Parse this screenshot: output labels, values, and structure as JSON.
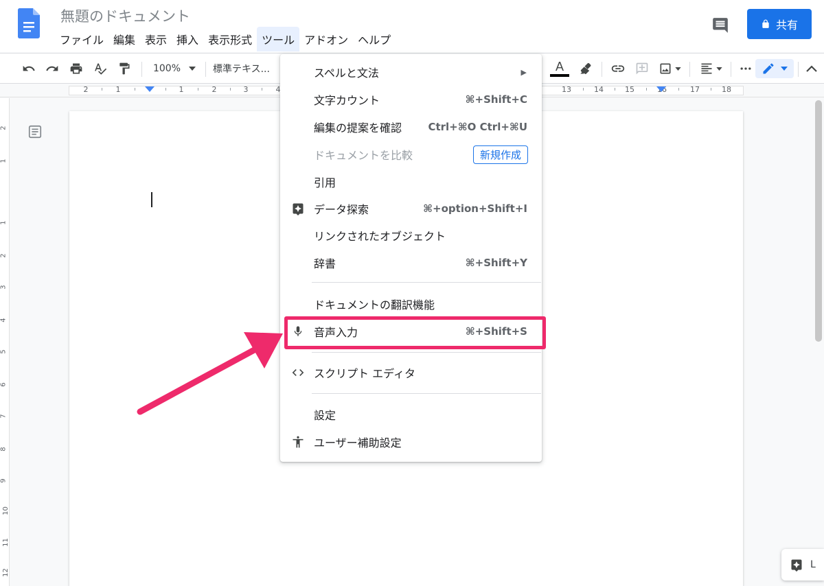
{
  "app": {
    "doc_title": "無題のドキュメント",
    "share_label": "共有",
    "menus": [
      {
        "label": "ファイル",
        "active": false
      },
      {
        "label": "編集",
        "active": false
      },
      {
        "label": "表示",
        "active": false
      },
      {
        "label": "挿入",
        "active": false
      },
      {
        "label": "表示形式",
        "active": false
      },
      {
        "label": "ツール",
        "active": true
      },
      {
        "label": "アドオン",
        "active": false
      },
      {
        "label": "ヘルプ",
        "active": false
      }
    ]
  },
  "toolbar": {
    "zoom": "100%",
    "style": "標準テキス..."
  },
  "ruler": {
    "labels": [
      "2",
      "1",
      "1",
      "2",
      "3",
      "4",
      "13",
      "14",
      "15",
      "16",
      "17",
      "18"
    ],
    "vlabels": [
      "2",
      "1",
      "1",
      "2",
      "3",
      "4",
      "5",
      "6",
      "7",
      "8",
      "9",
      "10",
      "11",
      "12"
    ]
  },
  "tools_menu": {
    "items": [
      {
        "label": "スペルと文法",
        "shortcut": "",
        "submenu": true,
        "icon": "",
        "disabled": false
      },
      {
        "label": "文字カウント",
        "shortcut": "⌘+Shift+C",
        "icon": ""
      },
      {
        "label": "編集の提案を確認",
        "shortcut": "Ctrl+⌘O Ctrl+⌘U",
        "icon": ""
      },
      {
        "label": "ドキュメントを比較",
        "shortcut": "",
        "badge": "新規作成",
        "icon": "",
        "disabled": true
      },
      {
        "label": "引用",
        "shortcut": "",
        "icon": ""
      },
      {
        "label": "データ探索",
        "shortcut": "⌘+option+Shift+I",
        "icon": "explore-icon"
      },
      {
        "label": "リンクされたオブジェクト",
        "shortcut": "",
        "icon": ""
      },
      {
        "label": "辞書",
        "shortcut": "⌘+Shift+Y",
        "icon": ""
      },
      {
        "label": "ドキュメントの翻訳機能",
        "shortcut": "",
        "icon": ""
      },
      {
        "label": "音声入力",
        "shortcut": "⌘+Shift+S",
        "icon": "microphone-icon",
        "highlighted": true
      },
      {
        "label": "スクリプト エディタ",
        "shortcut": "",
        "icon": "code-icon"
      },
      {
        "label": "設定",
        "shortcut": "",
        "icon": ""
      },
      {
        "label": "ユーザー補助設定",
        "shortcut": "",
        "icon": "accessibility-icon"
      }
    ]
  },
  "explore_label": "L",
  "colors": {
    "brand_blue": "#1a73e8",
    "highlight_pink": "#ee2a6b",
    "text_color_bar": "#000000"
  }
}
